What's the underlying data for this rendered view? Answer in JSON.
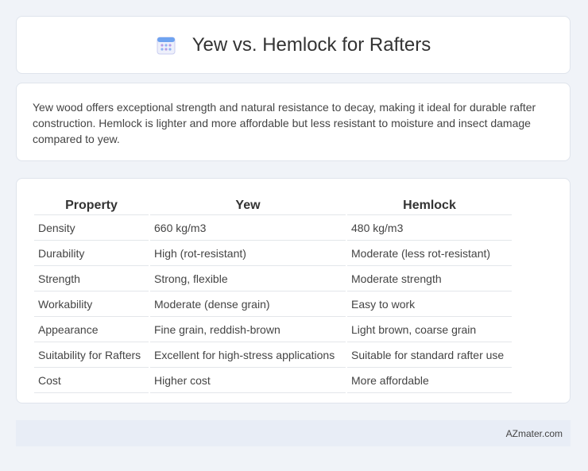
{
  "header": {
    "title": "Yew vs. Hemlock for Rafters",
    "icon": "calendar-icon"
  },
  "summary": {
    "text": "Yew wood offers exceptional strength and natural resistance to decay, making it ideal for durable rafter construction. Hemlock is lighter and more affordable but less resistant to moisture and insect damage compared to yew."
  },
  "table": {
    "headers": [
      "Property",
      "Yew",
      "Hemlock"
    ],
    "rows": [
      [
        "Density",
        "660 kg/m3",
        "480 kg/m3"
      ],
      [
        "Durability",
        "High (rot-resistant)",
        "Moderate (less rot-resistant)"
      ],
      [
        "Strength",
        "Strong, flexible",
        "Moderate strength"
      ],
      [
        "Workability",
        "Moderate (dense grain)",
        "Easy to work"
      ],
      [
        "Appearance",
        "Fine grain, reddish-brown",
        "Light brown, coarse grain"
      ],
      [
        "Suitability for Rafters",
        "Excellent for high-stress applications",
        "Suitable for standard rafter use"
      ],
      [
        "Cost",
        "Higher cost",
        "More affordable"
      ]
    ]
  },
  "footer": {
    "text": "AZmater.com"
  }
}
